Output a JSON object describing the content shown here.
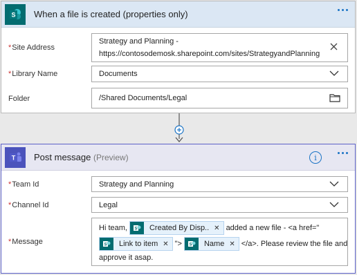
{
  "trigger": {
    "title": "When a file is created (properties only)",
    "icon": "sharepoint-icon",
    "fields": {
      "site_address": {
        "label": "Site Address",
        "value_line1": "Strategy and Planning -",
        "value_line2": "https://contosodemosk.sharepoint.com/sites/StrategyandPlanning"
      },
      "library_name": {
        "label": "Library Name",
        "value": "Documents"
      },
      "folder": {
        "label": "Folder",
        "value": "/Shared Documents/Legal"
      }
    }
  },
  "action": {
    "title": "Post message",
    "preview": "(Preview)",
    "icon": "teams-icon",
    "fields": {
      "team_id": {
        "label": "Team Id",
        "value": "Strategy and Planning"
      },
      "channel_id": {
        "label": "Channel Id",
        "value": "Legal"
      },
      "message": {
        "label": "Message",
        "text1": "Hi team,",
        "token1": "Created By Disp..",
        "text2": "added a new file - <a href=\"",
        "token2": "Link to item",
        "text3": "\">",
        "token3": "Name",
        "text4": "</a>. Please review the file and",
        "text5": "approve it asap."
      }
    }
  },
  "colors": {
    "sharepoint": "#036c70",
    "teams": "#4b53bc",
    "accent": "#1a73c5",
    "required": "#cc3333"
  }
}
